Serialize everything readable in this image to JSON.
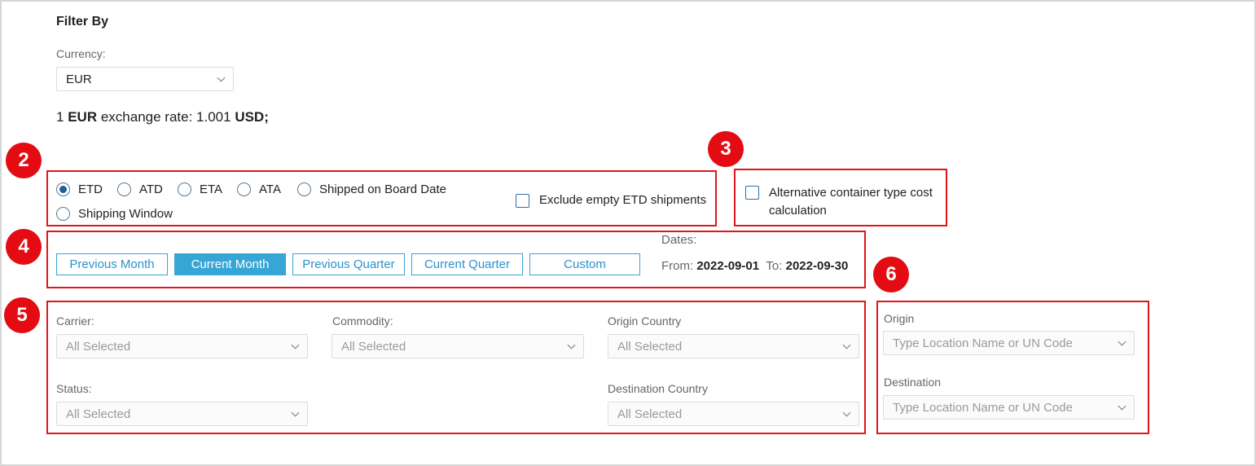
{
  "filter": {
    "title": "Filter By",
    "currency_label": "Currency:",
    "currency_value": "EUR",
    "rate": {
      "prefix": "1",
      "from_code": "EUR",
      "middle": "exchange rate: 1.001",
      "to_code": "USD;"
    }
  },
  "badges": [
    "2",
    "3",
    "4",
    "5",
    "6"
  ],
  "date_type": {
    "options": [
      "ETD",
      "ATD",
      "ETA",
      "ATA",
      "Shipped on Board Date",
      "Shipping Window"
    ],
    "selected": "ETD",
    "exclude_label": "Exclude empty ETD shipments"
  },
  "alt_container": {
    "label_line1": "Alternative container type cost",
    "label_line2": "calculation"
  },
  "periods": {
    "buttons": [
      "Previous Month",
      "Current Month",
      "Previous Quarter",
      "Current Quarter",
      "Custom"
    ],
    "active": "Current Month",
    "dates_label": "Dates:",
    "from_label": "From:",
    "from_value": "2022-09-01",
    "to_label": "To:",
    "to_value": "2022-09-30"
  },
  "filters": {
    "carrier_label": "Carrier:",
    "carrier_value": "All Selected",
    "commodity_label": "Commodity:",
    "commodity_value": "All Selected",
    "origin_country_label": "Origin Country",
    "origin_country_value": "All Selected",
    "status_label": "Status:",
    "status_value": "All Selected",
    "destination_country_label": "Destination Country",
    "destination_country_value": "All Selected"
  },
  "locations": {
    "origin_label": "Origin",
    "origin_placeholder": "Type Location Name or UN Code",
    "destination_label": "Destination",
    "destination_placeholder": "Type Location Name or UN Code"
  },
  "colors": {
    "annotation_red": "#e0161b",
    "primary_blue": "#35a6d6",
    "radio_selected": "#1f5e97"
  }
}
